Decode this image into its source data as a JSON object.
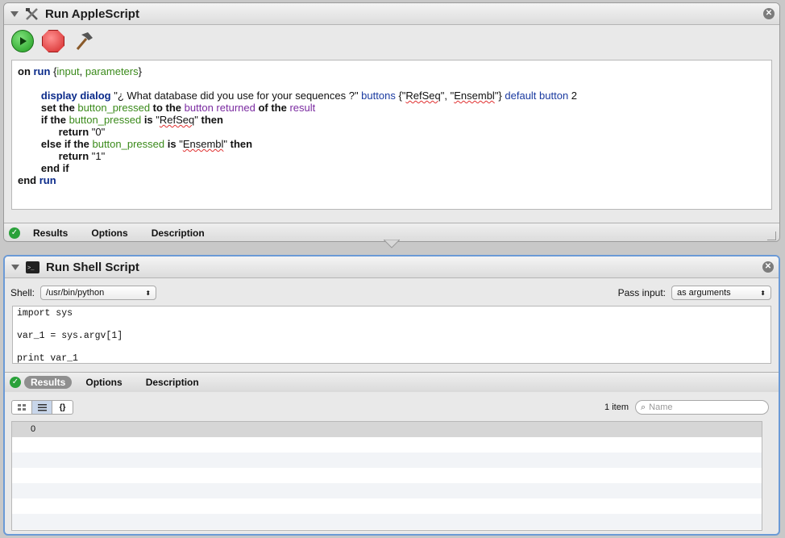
{
  "applescript": {
    "title": "Run AppleScript",
    "code_lines": [
      [
        {
          "t": "on ",
          "c": "kb"
        },
        {
          "t": "run",
          "c": "kw"
        },
        {
          "t": " {",
          "c": ""
        },
        {
          "t": "input",
          "c": "vr"
        },
        {
          "t": ", ",
          "c": ""
        },
        {
          "t": "parameters",
          "c": "vr"
        },
        {
          "t": "}",
          "c": ""
        }
      ],
      [],
      [
        {
          "t": "        ",
          "c": ""
        },
        {
          "t": "display dialog",
          "c": "kw"
        },
        {
          "t": " \"¿ What database did you use for your sequences ?\" ",
          "c": ""
        },
        {
          "t": "buttons",
          "c": "ap"
        },
        {
          "t": " {\"",
          "c": ""
        },
        {
          "t": "RefSeq",
          "c": "sq"
        },
        {
          "t": "\", \"",
          "c": ""
        },
        {
          "t": "Ensembl",
          "c": "sq"
        },
        {
          "t": "\"} ",
          "c": ""
        },
        {
          "t": "default button",
          "c": "ap"
        },
        {
          "t": " 2",
          "c": ""
        }
      ],
      [
        {
          "t": "        ",
          "c": ""
        },
        {
          "t": "set the ",
          "c": "kb"
        },
        {
          "t": "button_pressed",
          "c": "vr"
        },
        {
          "t": " to the ",
          "c": "kb"
        },
        {
          "t": "button returned",
          "c": "pu"
        },
        {
          "t": " of the ",
          "c": "kb"
        },
        {
          "t": "result",
          "c": "pu"
        }
      ],
      [
        {
          "t": "        ",
          "c": ""
        },
        {
          "t": "if the ",
          "c": "kb"
        },
        {
          "t": "button_pressed",
          "c": "vr"
        },
        {
          "t": " is ",
          "c": "kb"
        },
        {
          "t": "\"",
          "c": ""
        },
        {
          "t": "RefSeq",
          "c": "sq"
        },
        {
          "t": "\"",
          "c": ""
        },
        {
          "t": " then",
          "c": "kb"
        }
      ],
      [
        {
          "t": "              ",
          "c": ""
        },
        {
          "t": "return",
          "c": "kb"
        },
        {
          "t": " \"0\"",
          "c": ""
        }
      ],
      [
        {
          "t": "        ",
          "c": ""
        },
        {
          "t": "else if the ",
          "c": "kb"
        },
        {
          "t": "button_pressed",
          "c": "vr"
        },
        {
          "t": " is ",
          "c": "kb"
        },
        {
          "t": "\"",
          "c": ""
        },
        {
          "t": "Ensembl",
          "c": "sq"
        },
        {
          "t": "\"",
          "c": ""
        },
        {
          "t": " then",
          "c": "kb"
        }
      ],
      [
        {
          "t": "              ",
          "c": ""
        },
        {
          "t": "return",
          "c": "kb"
        },
        {
          "t": " \"1\"",
          "c": ""
        }
      ],
      [
        {
          "t": "        ",
          "c": ""
        },
        {
          "t": "end if",
          "c": "kb"
        }
      ],
      [
        {
          "t": "end ",
          "c": "kb"
        },
        {
          "t": "run",
          "c": "kw"
        }
      ]
    ],
    "tabs": [
      "Results",
      "Options",
      "Description"
    ]
  },
  "shell": {
    "title": "Run Shell Script",
    "shell_label": "Shell:",
    "shell_value": "/usr/bin/python",
    "pass_input_label": "Pass input:",
    "pass_input_value": "as arguments",
    "code_lines": [
      "import sys",
      "",
      "var_1 = sys.argv[1]",
      "",
      "print var_1"
    ],
    "tabs": [
      "Results",
      "Options",
      "Description"
    ],
    "active_tab": "Results",
    "item_count": "1 item",
    "search_placeholder": "Name",
    "view_buttons": [
      "grid-view-icon",
      "list-view-icon",
      "braces-view-icon"
    ],
    "results": [
      "0"
    ]
  },
  "colors": {
    "accent": "#6b9ad6",
    "check": "#2aa13a"
  }
}
